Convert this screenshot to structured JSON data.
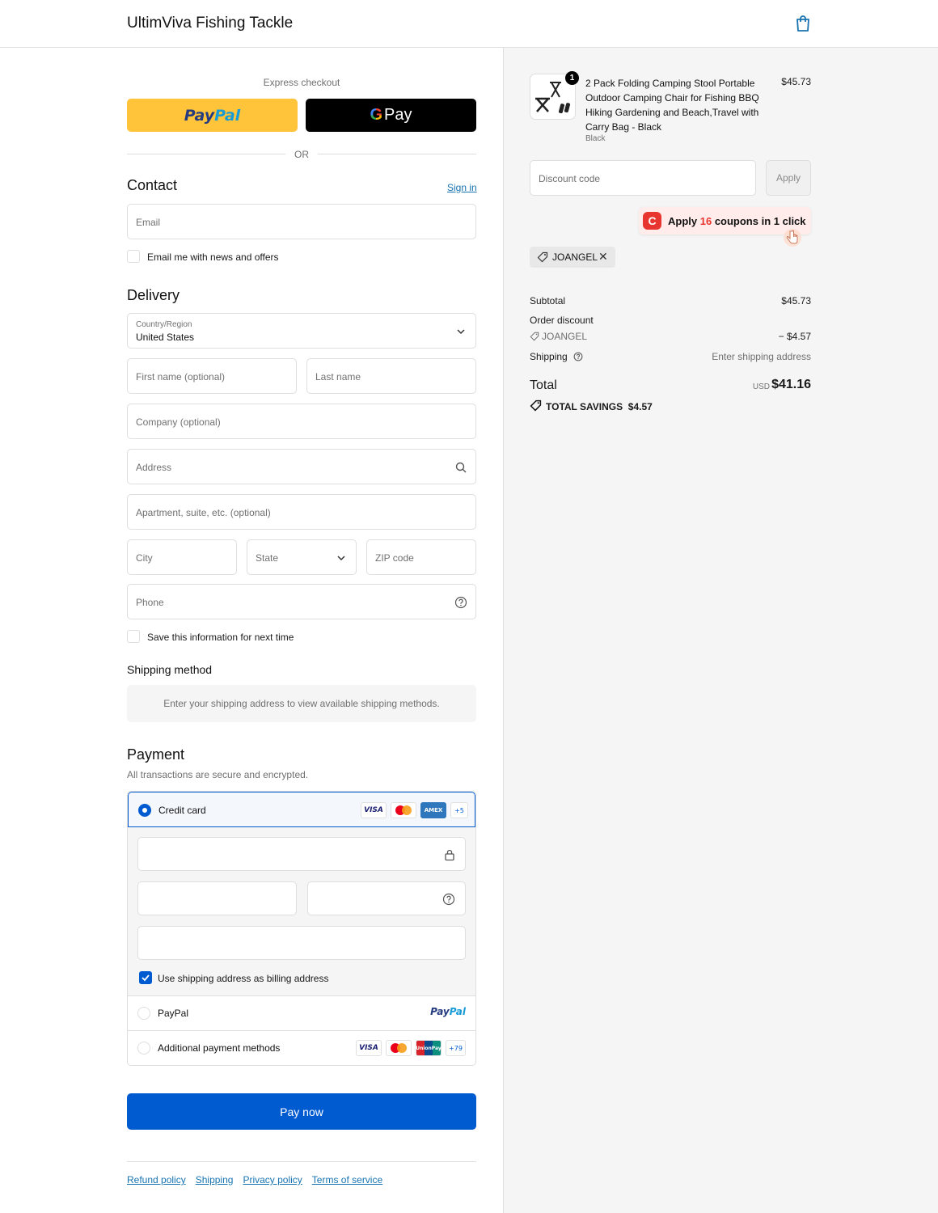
{
  "header": {
    "store_name": "UltimViva Fishing Tackle",
    "cart_icon": "shopping-bag-icon"
  },
  "express": {
    "label": "Express checkout",
    "paypal_1": "Pay",
    "paypal_2": "Pal",
    "gpay_label": "Pay",
    "or": "OR"
  },
  "contact": {
    "title": "Contact",
    "sign_in": "Sign in",
    "email_placeholder": "Email",
    "news_label": "Email me with news and offers"
  },
  "delivery": {
    "title": "Delivery",
    "country_label": "Country/Region",
    "country_value": "United States",
    "first_name": "First name (optional)",
    "last_name": "Last name",
    "company": "Company (optional)",
    "address": "Address",
    "apartment": "Apartment, suite, etc. (optional)",
    "city": "City",
    "state": "State",
    "zip": "ZIP code",
    "phone": "Phone",
    "save_info": "Save this information for next time"
  },
  "shipping_method": {
    "title": "Shipping method",
    "note": "Enter your shipping address to view available shipping methods."
  },
  "payment": {
    "title": "Payment",
    "subtitle": "All transactions are secure and encrypted.",
    "credit_card": "Credit card",
    "cc_more": "+5",
    "billing_same": "Use shipping address as billing address",
    "paypal": "PayPal",
    "additional": "Additional payment methods",
    "additional_more": "+79",
    "visa": "VISA",
    "amex": "AMEX",
    "unionpay": "UnionPay"
  },
  "pay_now": "Pay now",
  "footer": {
    "links": [
      "Refund policy",
      "Shipping",
      "Privacy policy",
      "Terms of service"
    ]
  },
  "summary": {
    "product": {
      "qty": "1",
      "title": "2 Pack Folding Camping Stool Portable Outdoor Camping Chair for Fishing BBQ Hiking Gardening and Beach,Travel with Carry Bag - Black",
      "variant": "Black",
      "price": "$45.73"
    },
    "discount_placeholder": "Discount code",
    "apply": "Apply",
    "coupon_pre": "Apply ",
    "coupon_num": "16",
    "coupon_post": " coupons in 1 click",
    "tag": "JOANGEL",
    "subtotal_label": "Subtotal",
    "subtotal": "$45.73",
    "order_discount_label": "Order discount",
    "discount_code": "JOANGEL",
    "discount_amount": "− $4.57",
    "shipping_label": "Shipping",
    "shipping_value": "Enter shipping address",
    "total_label": "Total",
    "currency": "USD",
    "total": "$41.16",
    "savings_label": "TOTAL SAVINGS",
    "savings": "$4.57"
  },
  "colors": {
    "accent": "#005bd1",
    "link": "#1773b0",
    "paypal_yellow": "#ffc439",
    "coupon_red": "#e8352f"
  }
}
